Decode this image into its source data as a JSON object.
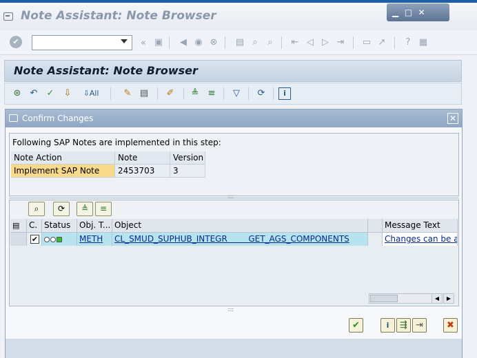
{
  "window": {
    "title": "Note Assistant: Note Browser",
    "controls": [
      "minimize",
      "maximize",
      "close"
    ]
  },
  "system_toolbar": {
    "command_field_value": "",
    "icons": [
      "enter-icon",
      "back-icon",
      "save-icon",
      "exit-icon",
      "cancel-icon",
      "print-icon",
      "find-icon",
      "find-next-icon",
      "first-page-icon",
      "previous-page-icon",
      "next-page-icon",
      "last-page-icon",
      "new-session-icon",
      "shortcut-icon",
      "help-icon",
      "layout-icon"
    ]
  },
  "app": {
    "header_title": "Note Assistant: Note Browser",
    "toolbar_icons": [
      "implement-icon",
      "reset-icon",
      "check-icon",
      "download-icon",
      "download-all-icon",
      "note-icon",
      "document-icon",
      "edit-icon",
      "sort-ascending-icon",
      "sort-descending-icon",
      "filter-icon",
      "refresh-icon",
      "info-icon"
    ],
    "toolbar_text": {
      "all": "All"
    }
  },
  "dialog": {
    "title": "Confirm Changes",
    "intro": "Following SAP Notes are implemented in this step:",
    "notes_table": {
      "headers": [
        "Note Action",
        "Note",
        "Version"
      ],
      "rows": [
        [
          "Implement SAP Note",
          "2453703",
          "3"
        ]
      ]
    },
    "alv_toolbar": [
      "details-icon",
      "refresh-icon",
      "sort-ascending-icon",
      "sort-descending-icon"
    ],
    "grid": {
      "headers": [
        "C.",
        "Status",
        "Obj. T...",
        "Object",
        "",
        "Message Text"
      ],
      "rows": [
        {
          "checked": true,
          "obj_type": "METH",
          "object": "CL_SMUD_SUPHUB_INTEGR        GET_AGS_COMPONENTS",
          "message": "Changes can be ap"
        }
      ]
    },
    "footer_buttons": [
      "confirm-icon",
      "info-icon",
      "export-icon",
      "import-icon",
      "cancel-icon"
    ]
  },
  "colors": {
    "dialog_title_bg": "#8ea6c4",
    "highlight_row": "#b7e3ef",
    "note_action_bg": "#f9d98a",
    "link": "#0a2a8c",
    "status_green": "#2ec22e"
  }
}
